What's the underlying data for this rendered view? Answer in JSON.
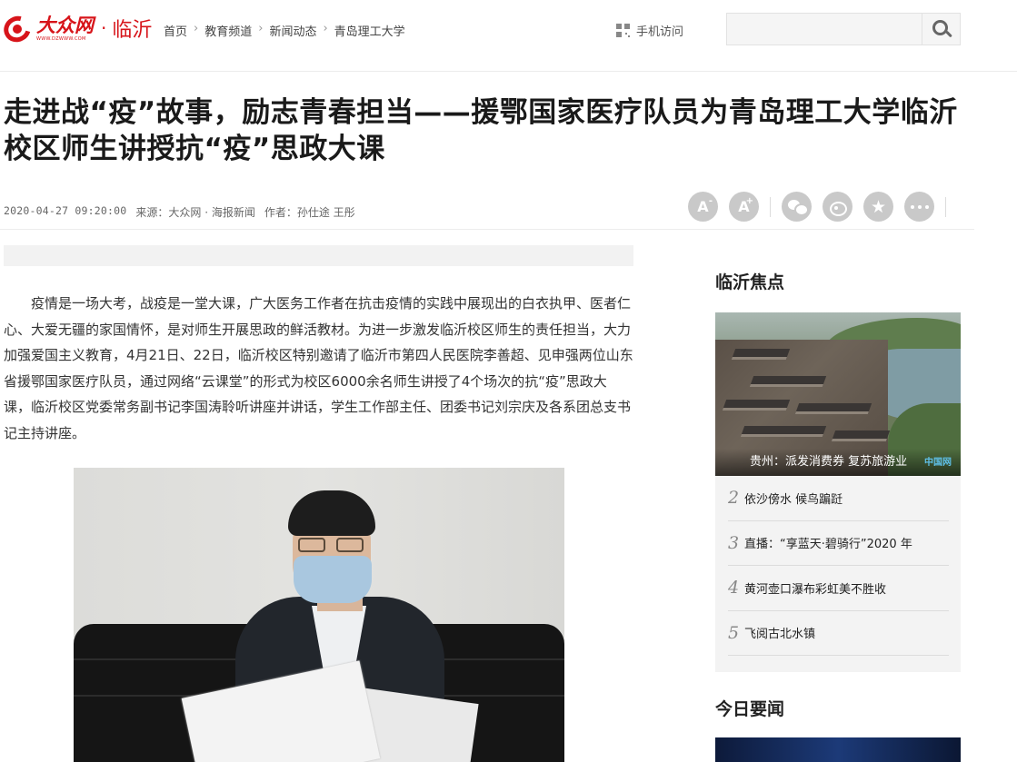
{
  "header": {
    "logo_name": "大众网",
    "logo_url_text": "WWW.DZWWW.COM",
    "logo_separator": "·",
    "logo_city": "临沂",
    "breadcrumb": [
      "首页",
      "教育频道",
      "新闻动态",
      "青岛理工大学"
    ],
    "breadcrumb_separator": "›",
    "mobile_label": "手机访问",
    "search_placeholder": ""
  },
  "article": {
    "title": "走进战“疫”故事，励志青春担当——援鄂国家医疗队员为青岛理工大学临沂校区师生讲授抗“疫”思政大课",
    "datetime": "2020-04-27 09:20:00",
    "source_label": "来源：",
    "source": "大众网 · 海报新闻",
    "author_label": "作者：",
    "author": "孙仕途 王彤",
    "tools": {
      "font_smaller": "A",
      "font_smaller_sup": "-",
      "font_larger": "A",
      "font_larger_sup": "+",
      "star": "★"
    },
    "body": "疫情是一场大考，战疫是一堂大课，广大医务工作者在抗击疫情的实践中展现出的白衣执甲、医者仁心、大爱无疆的家国情怀，是对师生开展思政的鲜活教材。为进一步激发临沂校区师生的责任担当，大力加强爱国主义教育，4月21日、22日，临沂校区特别邀请了临沂市第四人民医院李善超、见申强两位山东省援鄂国家医疗队员，通过网络“云课堂”的形式为校区6000余名师生讲授了4个场次的抗“疫”思政大课，临沂校区党委常务副书记李国涛聆听讲座并讲话，学生工作部主任、团委书记刘宗庆及各系团总支书记主持讲座。"
  },
  "sidebar": {
    "focus_title": "临沂焦点",
    "feature_caption": "贵州：派发消费券 复苏旅游业",
    "feature_logo": "中国网",
    "items": [
      {
        "num": "2",
        "text": "依沙傍水 候鸟蹁跹"
      },
      {
        "num": "3",
        "text": "直播：“享蓝天·碧骑行”2020 年"
      },
      {
        "num": "4",
        "text": "黄河壶口瀑布彩虹美不胜收"
      },
      {
        "num": "5",
        "text": "飞阅古北水镇"
      }
    ],
    "today_title": "今日要闻"
  },
  "colors": {
    "brand_red": "#d7141a",
    "tool_gray": "#c9c9c9",
    "sidebar_bg": "#f3f3f3"
  },
  "icons": [
    "logo-mark-icon",
    "qr-code-icon",
    "search-icon",
    "wechat-icon",
    "weibo-icon",
    "star-icon",
    "more-icon"
  ]
}
